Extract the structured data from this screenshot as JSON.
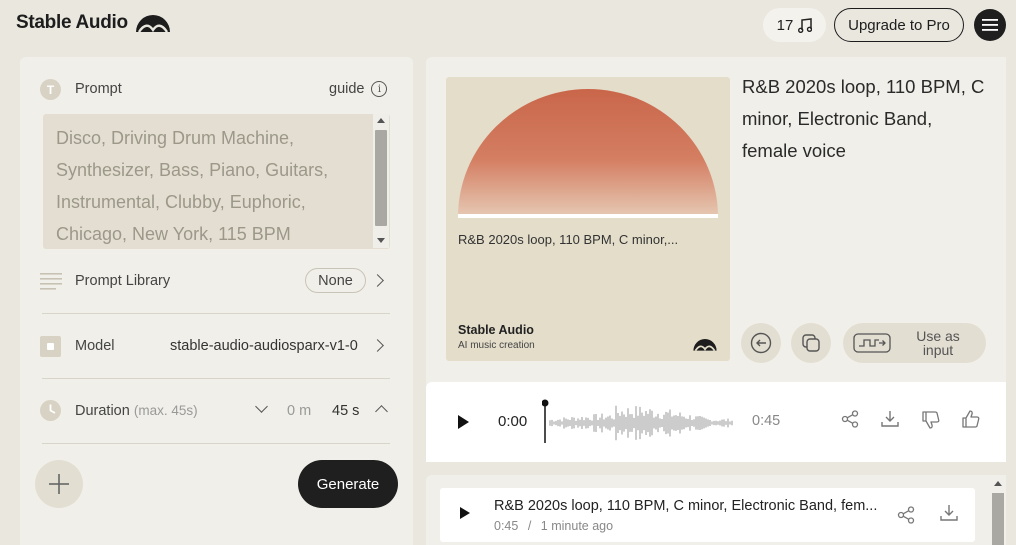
{
  "header": {
    "brand": "Stable Audio",
    "credits": "17",
    "upgrade_label": "Upgrade to Pro"
  },
  "left": {
    "prompt_label": "Prompt",
    "guide_label": "guide",
    "prompt_placeholder": "Disco, Driving Drum Machine, Synthesizer, Bass, Piano, Guitars, Instrumental, Clubby, Euphoric, Chicago, New York, 115 BPM",
    "prompt_library_label": "Prompt Library",
    "prompt_library_value": "None",
    "model_label": "Model",
    "model_value": "stable-audio-audiosparx-v1-0",
    "duration_label": "Duration",
    "duration_hint": "(max. 45s)",
    "duration_minutes": "0 m",
    "duration_seconds": "45 s",
    "generate_label": "Generate"
  },
  "track": {
    "title": "R&B 2020s loop, 110 BPM, C minor, Electronic Band, female voice",
    "cover_caption": "R&B 2020s loop, 110 BPM, C minor,...",
    "cover_brand": "Stable Audio",
    "cover_sub": "AI music creation",
    "use_as_input_label": "Use as input",
    "time_current": "0:00",
    "time_total": "0:45"
  },
  "history": [
    {
      "title": "R&B 2020s loop, 110 BPM, C minor, Electronic Band, fem...",
      "duration": "0:45",
      "age": "1 minute ago"
    }
  ],
  "colors": {
    "background": "#eae7df",
    "panel": "#f1efe9",
    "accent_dark": "#1f1f1f",
    "cover_sun_top": "#c9664a",
    "cover_bg": "#e3ddca"
  }
}
